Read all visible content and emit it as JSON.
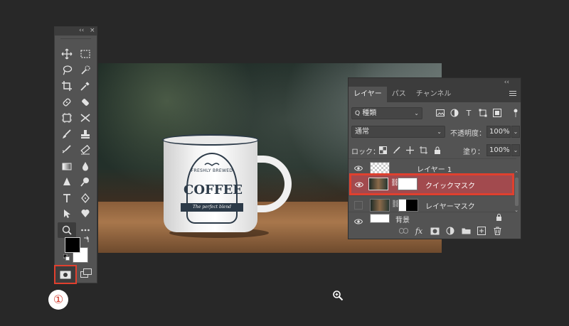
{
  "tools_panel": {
    "collapse_glyph": "‹‹",
    "close_glyph": "×",
    "tools": [
      "move-icon",
      "marquee-icon",
      "lasso-icon",
      "quick-select-icon",
      "crop-icon",
      "eyedropper-icon",
      "healing-brush-icon",
      "patch-icon",
      "frame-icon",
      "content-aware-move-icon",
      "brush-icon",
      "clone-stamp-icon",
      "history-brush-icon",
      "eraser-icon",
      "gradient-icon",
      "blur-icon",
      "sharpen-icon",
      "dodge-icon",
      "type-icon",
      "pen-icon",
      "path-select-icon",
      "custom-shape-icon",
      "zoom-icon",
      "more-icons"
    ],
    "selected_tool": "zoom-icon",
    "foreground_color": "#000000",
    "background_color": "#ffffff"
  },
  "annotation": {
    "step_number": "①",
    "highlight_color": "#e0402e"
  },
  "photo": {
    "logo_top": "FRESHLY BREWED",
    "logo_main": "COFFEE",
    "logo_ribbon": "The perfect blend"
  },
  "layers_panel": {
    "collapse_glyph": "‹‹",
    "tabs": [
      {
        "label": "レイヤー",
        "active": true
      },
      {
        "label": "パス",
        "active": false
      },
      {
        "label": "チャンネル",
        "active": false
      }
    ],
    "filter": {
      "label": "種類",
      "search_glyph": "Q"
    },
    "blend_mode": "通常",
    "opacity_label": "不透明度：",
    "opacity_value": "100%",
    "lock_label": "ロック：",
    "fill_label": "塗り：",
    "fill_value": "100%",
    "layers": [
      {
        "name": "レイヤー 1",
        "visible": true,
        "selected": false
      },
      {
        "name": "クイックマスク",
        "visible": true,
        "selected": true
      },
      {
        "name": "レイヤーマスク",
        "visible": false,
        "selected": false
      },
      {
        "name": "背景",
        "visible": true,
        "selected": false,
        "locked": true
      }
    ],
    "footer_icons": [
      "link-icon",
      "fx-icon",
      "mask-icon",
      "adjustment-icon",
      "folder-icon",
      "new-layer-icon",
      "trash-icon"
    ],
    "fx_label": "fx"
  }
}
